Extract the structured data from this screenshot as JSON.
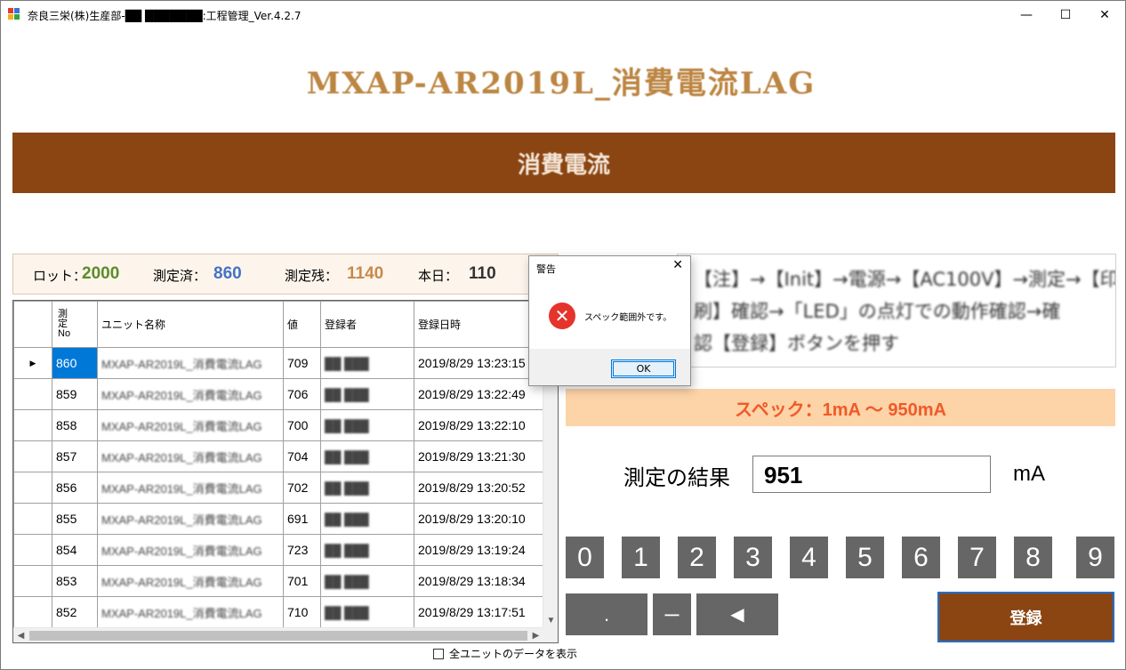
{
  "window": {
    "title": "奈良三栄(株)生産部-██ ███████:工程管理_Ver.4.2.7",
    "minimize_glyph": "—",
    "maximize_glyph": "☐",
    "close_glyph": "✕",
    "app_icon_colors": [
      "#e23b2e",
      "#3a73d8",
      "#f2b01e",
      "#37a53c"
    ]
  },
  "header": {
    "product_title": "MXAP-AR2019L_消費電流LAG",
    "process_name": "消費電流"
  },
  "counters": {
    "lot_label": "ロット：",
    "lot_value": "2000",
    "measured_label": "測定済：",
    "measured_value": "860",
    "remaining_label": "測定残：",
    "remaining_value": "1140",
    "today_label": "本日：",
    "today_value": "110",
    "colors": {
      "lot": "#5b8c2a",
      "measured": "#4472c4",
      "remaining": "#c8894a",
      "today": "#333333"
    }
  },
  "grid": {
    "columns": [
      "測定No",
      "ユニット名称",
      "値",
      "登録者",
      "登録日時"
    ],
    "no_header_lines": [
      "測",
      "定",
      "No"
    ],
    "current_row_marker": "▶",
    "rows": [
      {
        "no": "860",
        "unit": "MXAP-AR2019L_消費電流LAG",
        "value": "709",
        "user": "██ ███",
        "date": "2019/8/29  13:23:15"
      },
      {
        "no": "859",
        "unit": "MXAP-AR2019L_消費電流LAG",
        "value": "706",
        "user": "██ ███",
        "date": "2019/8/29  13:22:49"
      },
      {
        "no": "858",
        "unit": "MXAP-AR2019L_消費電流LAG",
        "value": "700",
        "user": "██ ███",
        "date": "2019/8/29  13:22:10"
      },
      {
        "no": "857",
        "unit": "MXAP-AR2019L_消費電流LAG",
        "value": "704",
        "user": "██ ███",
        "date": "2019/8/29  13:21:30"
      },
      {
        "no": "856",
        "unit": "MXAP-AR2019L_消費電流LAG",
        "value": "702",
        "user": "██ ███",
        "date": "2019/8/29  13:20:52"
      },
      {
        "no": "855",
        "unit": "MXAP-AR2019L_消費電流LAG",
        "value": "691",
        "user": "██ ███",
        "date": "2019/8/29  13:20:10"
      },
      {
        "no": "854",
        "unit": "MXAP-AR2019L_消費電流LAG",
        "value": "723",
        "user": "██ ███",
        "date": "2019/8/29  13:19:24"
      },
      {
        "no": "853",
        "unit": "MXAP-AR2019L_消費電流LAG",
        "value": "701",
        "user": "██ ███",
        "date": "2019/8/29  13:18:34"
      },
      {
        "no": "852",
        "unit": "MXAP-AR2019L_消費電流LAG",
        "value": "710",
        "user": "██ ███",
        "date": "2019/8/29  13:17:51"
      }
    ]
  },
  "show_all_label": "全ユニットのデータを表示",
  "instruction": {
    "lines": [
      "【注】→【Init】→電源→【AC100V】→測定→【印",
      "刷】確認→「LED」の点灯での動作確認→確",
      "認【登録】ボタンを押す"
    ]
  },
  "spec_text": "スペック：1mA ～ 950mA",
  "result": {
    "label": "測定の結果",
    "value": "951",
    "unit": "mA"
  },
  "keypad": {
    "digits": [
      "0",
      "1",
      "2",
      "3",
      "4",
      "5",
      "6",
      "7",
      "8",
      "9"
    ],
    "dot": ".",
    "minus": "ー",
    "backspace": "◀",
    "register": "登録"
  },
  "dialog": {
    "title": "警告",
    "close_glyph": "✕",
    "message": "スペック範囲外です。",
    "ok_label": "OK",
    "error_glyph": "✕"
  }
}
